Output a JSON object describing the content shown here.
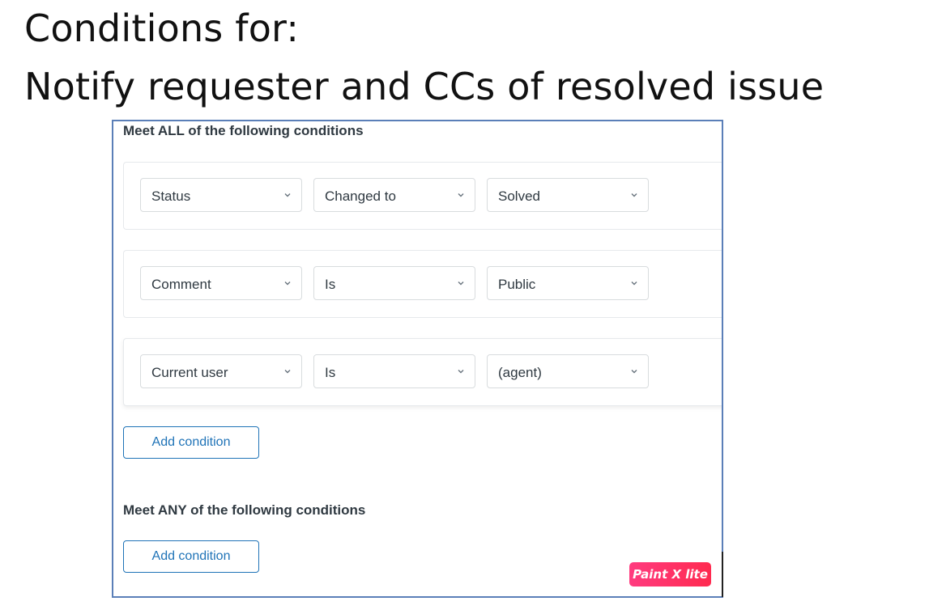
{
  "heading": {
    "line1": "Conditions for:",
    "line2": "Notify requester and CCs of resolved issue"
  },
  "all_section": {
    "title": "Meet ALL of the following conditions",
    "conditions": [
      {
        "field": "Status",
        "operator": "Changed to",
        "value": "Solved"
      },
      {
        "field": "Comment",
        "operator": "Is",
        "value": "Public"
      },
      {
        "field": "Current user",
        "operator": "Is",
        "value": "(agent)"
      }
    ],
    "add_button_label": "Add condition"
  },
  "any_section": {
    "title": "Meet ANY of the following conditions",
    "add_button_label": "Add condition"
  },
  "badge": {
    "text": "Paint X lite"
  },
  "colors": {
    "accent": "#1f73b7",
    "panel_border": "#5b7fb8",
    "badge": "#ff2a6a"
  }
}
